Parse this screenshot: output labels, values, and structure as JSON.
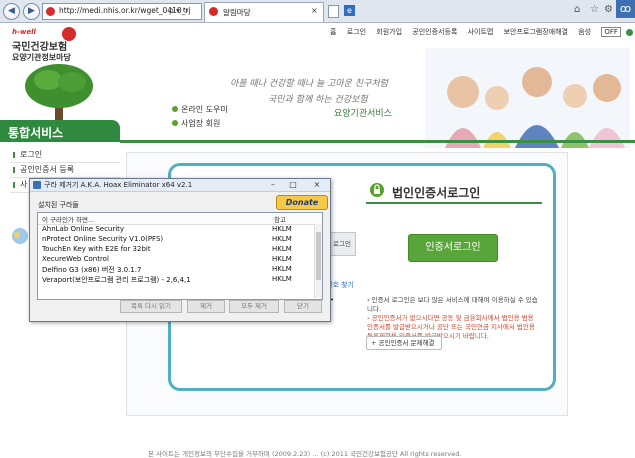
{
  "browser": {
    "address": "http://medi.nhis.or.kr/wget_0410_rj",
    "address_icons": "ρ ▾ ↻",
    "tab_title": "알림마당"
  },
  "header": {
    "logo_small": "h-well",
    "org_name": "국민건강보험",
    "org_sub": "요양기관정보마당",
    "top_nav": [
      "홈",
      "로그인",
      "회원가입",
      "공인인증서등록",
      "사이트맵",
      "보안프로그램장애해결",
      "음성",
      "OFF"
    ],
    "slogan_line1": "아플 때나 건강할 때나 늘 고마운 친구처럼",
    "slogan_line2": "국민과 함께 하는 건강보험",
    "slogan_line3": "요양기관서비스",
    "help_links": [
      "온라인 도우미",
      "사업장 회원"
    ]
  },
  "sidebar": {
    "title": "통합서비스",
    "items": [
      "로그인",
      "공인인증서 등록",
      "사"
    ]
  },
  "login": {
    "title_bold": "법인인증서",
    "title_rest": "로그인",
    "cert_button": "인증서로그인",
    "left_button": "로그인",
    "left_link": "번호 찾기",
    "notes": [
      "인증서 로그인은 보다 많은 서비스에 대해여 이용하실 수 있습니다.",
      "공인인증서가 없으시다면 공동 및 금융회사에서 법인용 범용 인증서를 발급받으시거나 공단 또는 국민연금 지사에서 법인용 등록제한용 인증서를 발급받으시기 바랍니다."
    ],
    "faq_button": "공인인증서 문제해결"
  },
  "footer": {
    "text": "본 사이트는 개인정보의 무단수집을 거부하며 (2009.2.23)   …   (c) 2011 국민건강보험공단 All rights reserved."
  },
  "popup": {
    "title": "구라 제거기 A.K.A. Hoax Eliminator x64 v2.1",
    "installed_label": "설치된 구라들",
    "donate": "Donate",
    "col_name": "이 구라인가 하면...",
    "col_ref": "참고",
    "rows": [
      {
        "name": "AhnLab Online Security",
        "key": "HKLM"
      },
      {
        "name": "nProtect Online Security V1.0(PFS)",
        "key": "HKLM"
      },
      {
        "name": "TouchEn Key with E2E for 32bit",
        "key": "HKLM"
      },
      {
        "name": "XecureWeb Control",
        "key": "HKLM"
      },
      {
        "name": "Delfino G3 (x86) 버전 3.0.1.7",
        "key": "HKLM"
      },
      {
        "name": "Veraport(보안프로그램 관리 프로그램) - 2,6,4,1",
        "key": "HKLM"
      }
    ],
    "buttons": [
      "목록 다시 읽기",
      "제거",
      "모두 제거",
      "닫기"
    ]
  }
}
